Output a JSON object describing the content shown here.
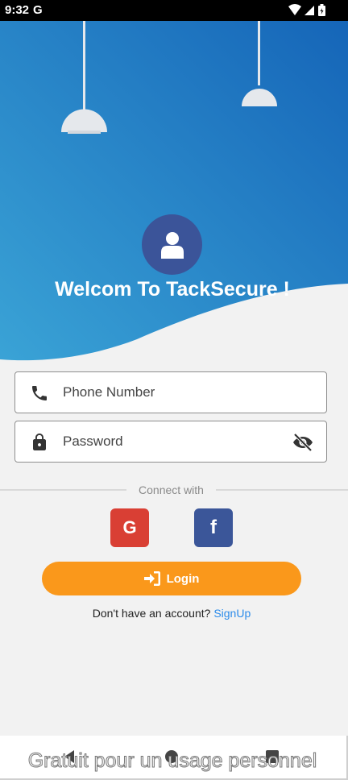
{
  "status_bar": {
    "time": "9:32",
    "google_indicator": "G",
    "icons": [
      "wifi-icon",
      "signal-icon",
      "battery-icon"
    ]
  },
  "header": {
    "title": "Welcom To TackSecure !",
    "avatar_icon": "user-icon",
    "gradient_colors": [
      "#3aa3d6",
      "#1565b8"
    ]
  },
  "form": {
    "phone": {
      "placeholder": "Phone Number",
      "value": "",
      "icon": "phone-icon"
    },
    "password": {
      "placeholder": "Password",
      "value": "",
      "icon": "lock-icon",
      "toggle_icon": "eye-off-icon"
    }
  },
  "social": {
    "label": "Connect with",
    "google": {
      "label": "G",
      "color": "#d93f34"
    },
    "facebook": {
      "label": "f",
      "color": "#3b5699"
    }
  },
  "login": {
    "label": "Login",
    "icon": "login-icon",
    "color": "#fa981b"
  },
  "signup": {
    "prompt": "Don't have an account?",
    "link": "SignUp"
  },
  "watermark": "Gratuit pour un usage personnel"
}
